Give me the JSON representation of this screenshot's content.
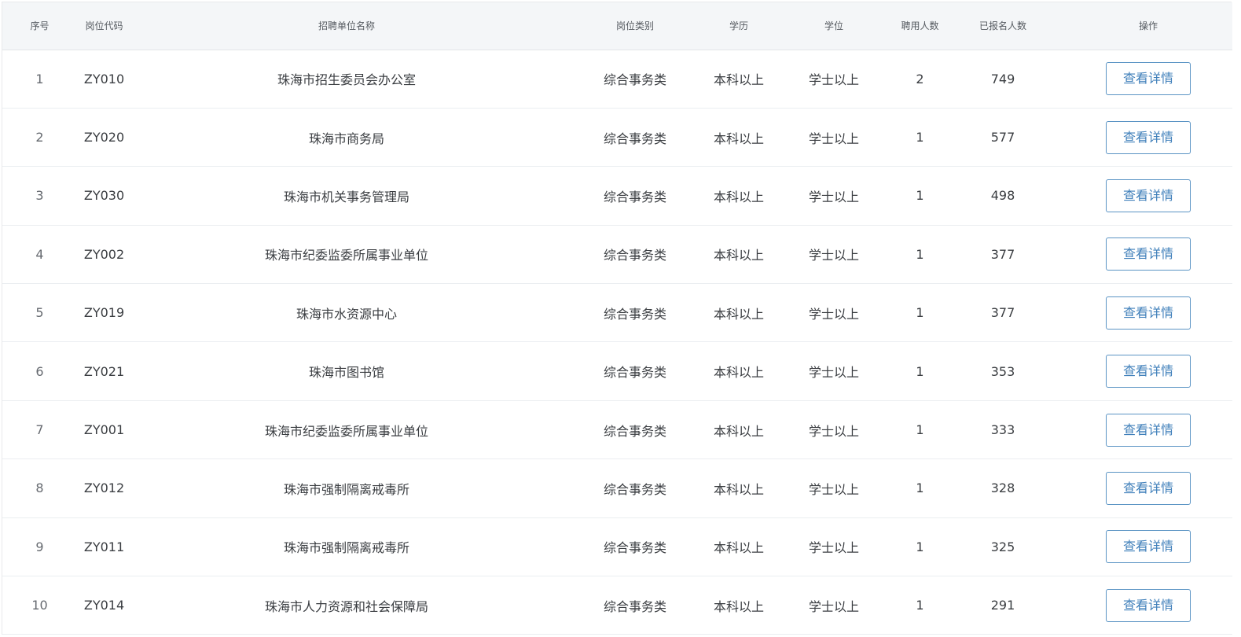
{
  "table": {
    "headers": {
      "index": "序号",
      "code": "岗位代码",
      "unit": "招聘单位名称",
      "category": "岗位类别",
      "education": "学历",
      "degree": "学位",
      "hire_count": "聘用人数",
      "applied_count": "已报名人数",
      "action": "操作"
    },
    "rows": [
      {
        "index": "1",
        "code": "ZY010",
        "unit": "珠海市招生委员会办公室",
        "category": "综合事务类",
        "education": "本科以上",
        "degree": "学士以上",
        "hire_count": "2",
        "applied_count": "749",
        "action_label": "查看详情"
      },
      {
        "index": "2",
        "code": "ZY020",
        "unit": "珠海市商务局",
        "category": "综合事务类",
        "education": "本科以上",
        "degree": "学士以上",
        "hire_count": "1",
        "applied_count": "577",
        "action_label": "查看详情"
      },
      {
        "index": "3",
        "code": "ZY030",
        "unit": "珠海市机关事务管理局",
        "category": "综合事务类",
        "education": "本科以上",
        "degree": "学士以上",
        "hire_count": "1",
        "applied_count": "498",
        "action_label": "查看详情"
      },
      {
        "index": "4",
        "code": "ZY002",
        "unit": "珠海市纪委监委所属事业单位",
        "category": "综合事务类",
        "education": "本科以上",
        "degree": "学士以上",
        "hire_count": "1",
        "applied_count": "377",
        "action_label": "查看详情"
      },
      {
        "index": "5",
        "code": "ZY019",
        "unit": "珠海市水资源中心",
        "category": "综合事务类",
        "education": "本科以上",
        "degree": "学士以上",
        "hire_count": "1",
        "applied_count": "377",
        "action_label": "查看详情"
      },
      {
        "index": "6",
        "code": "ZY021",
        "unit": "珠海市图书馆",
        "category": "综合事务类",
        "education": "本科以上",
        "degree": "学士以上",
        "hire_count": "1",
        "applied_count": "353",
        "action_label": "查看详情"
      },
      {
        "index": "7",
        "code": "ZY001",
        "unit": "珠海市纪委监委所属事业单位",
        "category": "综合事务类",
        "education": "本科以上",
        "degree": "学士以上",
        "hire_count": "1",
        "applied_count": "333",
        "action_label": "查看详情"
      },
      {
        "index": "8",
        "code": "ZY012",
        "unit": "珠海市强制隔离戒毒所",
        "category": "综合事务类",
        "education": "本科以上",
        "degree": "学士以上",
        "hire_count": "1",
        "applied_count": "328",
        "action_label": "查看详情"
      },
      {
        "index": "9",
        "code": "ZY011",
        "unit": "珠海市强制隔离戒毒所",
        "category": "综合事务类",
        "education": "本科以上",
        "degree": "学士以上",
        "hire_count": "1",
        "applied_count": "325",
        "action_label": "查看详情"
      },
      {
        "index": "10",
        "code": "ZY014",
        "unit": "珠海市人力资源和社会保障局",
        "category": "综合事务类",
        "education": "本科以上",
        "degree": "学士以上",
        "hire_count": "1",
        "applied_count": "291",
        "action_label": "查看详情"
      }
    ]
  },
  "colors": {
    "header_bg": "#f4f6f8",
    "border": "#ebeef1",
    "button_border": "#5b94c4",
    "button_text": "#3f7fba"
  }
}
